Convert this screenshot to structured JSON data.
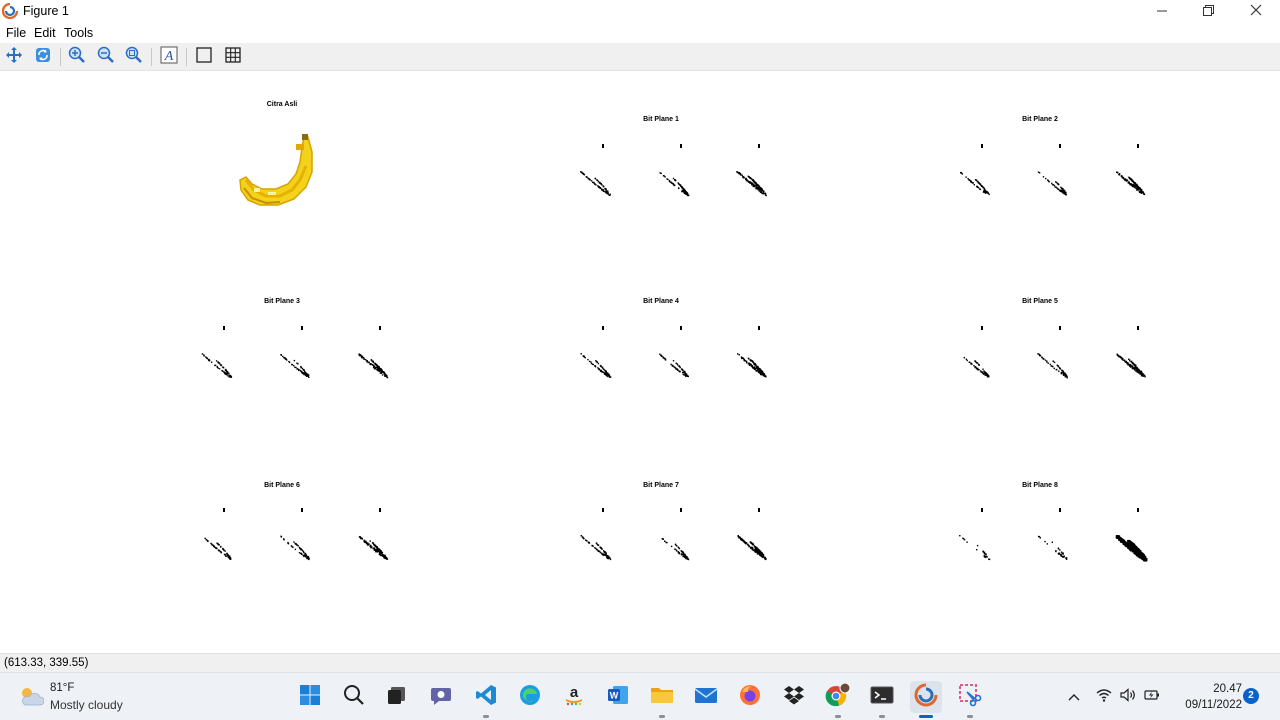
{
  "window": {
    "title": "Figure 1",
    "menu": [
      "File",
      "Edit",
      "Tools"
    ]
  },
  "toolbar": {
    "icons": [
      "pan-icon",
      "rotate-icon",
      "zoom-in-icon",
      "zoom-out-icon",
      "zoom-fit-icon",
      "insert-text-icon",
      "box-icon",
      "grid-icon"
    ]
  },
  "figure": {
    "original_title": "Citra Asli",
    "planes": [
      {
        "title": "Bit Plane 1"
      },
      {
        "title": "Bit Plane 2"
      },
      {
        "title": "Bit Plane 3"
      },
      {
        "title": "Bit Plane 4"
      },
      {
        "title": "Bit Plane 5"
      },
      {
        "title": "Bit Plane 6"
      },
      {
        "title": "Bit Plane 7"
      },
      {
        "title": "Bit Plane 8"
      }
    ]
  },
  "status": {
    "coordinates": "(613.33, 339.55)"
  },
  "taskbar": {
    "weather_temp": "81°F",
    "weather_condition": "Mostly cloudy",
    "time": "20.47",
    "date": "09/11/2022",
    "notification_count": "2",
    "apps": [
      "start-icon",
      "search-icon",
      "task-view-icon",
      "teams-chat-icon",
      "vscode-icon",
      "edge-icon",
      "amazon-icon",
      "word-icon",
      "file-explorer-icon",
      "mail-icon",
      "firefox-icon",
      "dropbox-icon",
      "chrome-icon",
      "terminal-icon",
      "octave-icon",
      "snipping-tool-icon"
    ]
  },
  "colors": {
    "accent": "#0a62c9",
    "banana_yellow": "#f2d21b",
    "banana_dark": "#d8a200"
  }
}
